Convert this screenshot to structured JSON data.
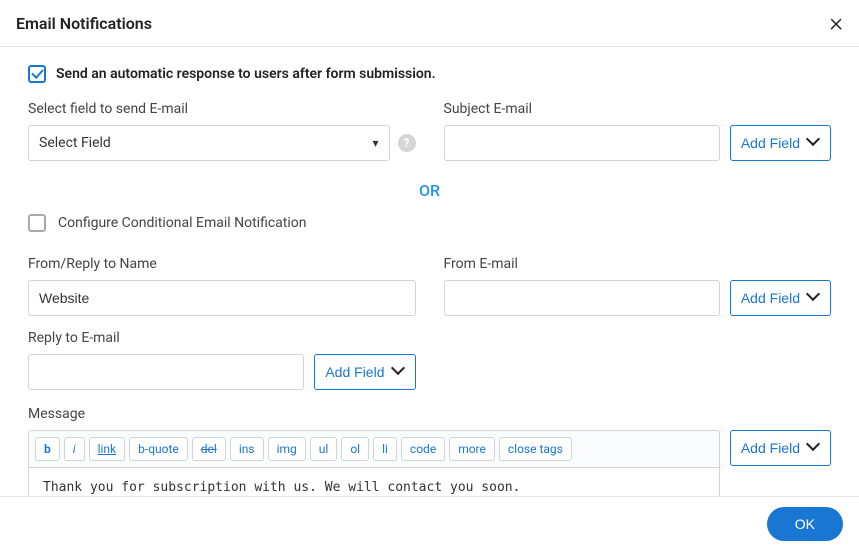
{
  "header": {
    "title": "Email Notifications"
  },
  "auto": {
    "checked": true,
    "label": "Send an automatic response to users after form submission."
  },
  "fields": {
    "select_field": {
      "label": "Select field to send E-mail",
      "value": "Select Field"
    },
    "subject": {
      "label": "Subject E-mail",
      "value": "",
      "add_btn": "Add Field"
    },
    "or": "OR",
    "conditional": {
      "checked": false,
      "label": "Configure Conditional Email Notification"
    },
    "from_name": {
      "label": "From/Reply to Name",
      "value": "Website"
    },
    "from_email": {
      "label": "From E-mail",
      "value": "",
      "add_btn": "Add Field"
    },
    "reply_to": {
      "label": "Reply to E-mail",
      "value": "",
      "add_btn": "Add Field"
    },
    "message": {
      "label": "Message",
      "add_btn": "Add Field",
      "toolbar": {
        "b": "b",
        "i": "i",
        "link": "link",
        "bquote": "b-quote",
        "del": "del",
        "ins": "ins",
        "img": "img",
        "ul": "ul",
        "ol": "ol",
        "li": "li",
        "code": "code",
        "more": "more",
        "close": "close tags"
      },
      "body": "Thank you for subscription with us. We will contact you soon."
    }
  },
  "footer": {
    "ok": "OK"
  }
}
